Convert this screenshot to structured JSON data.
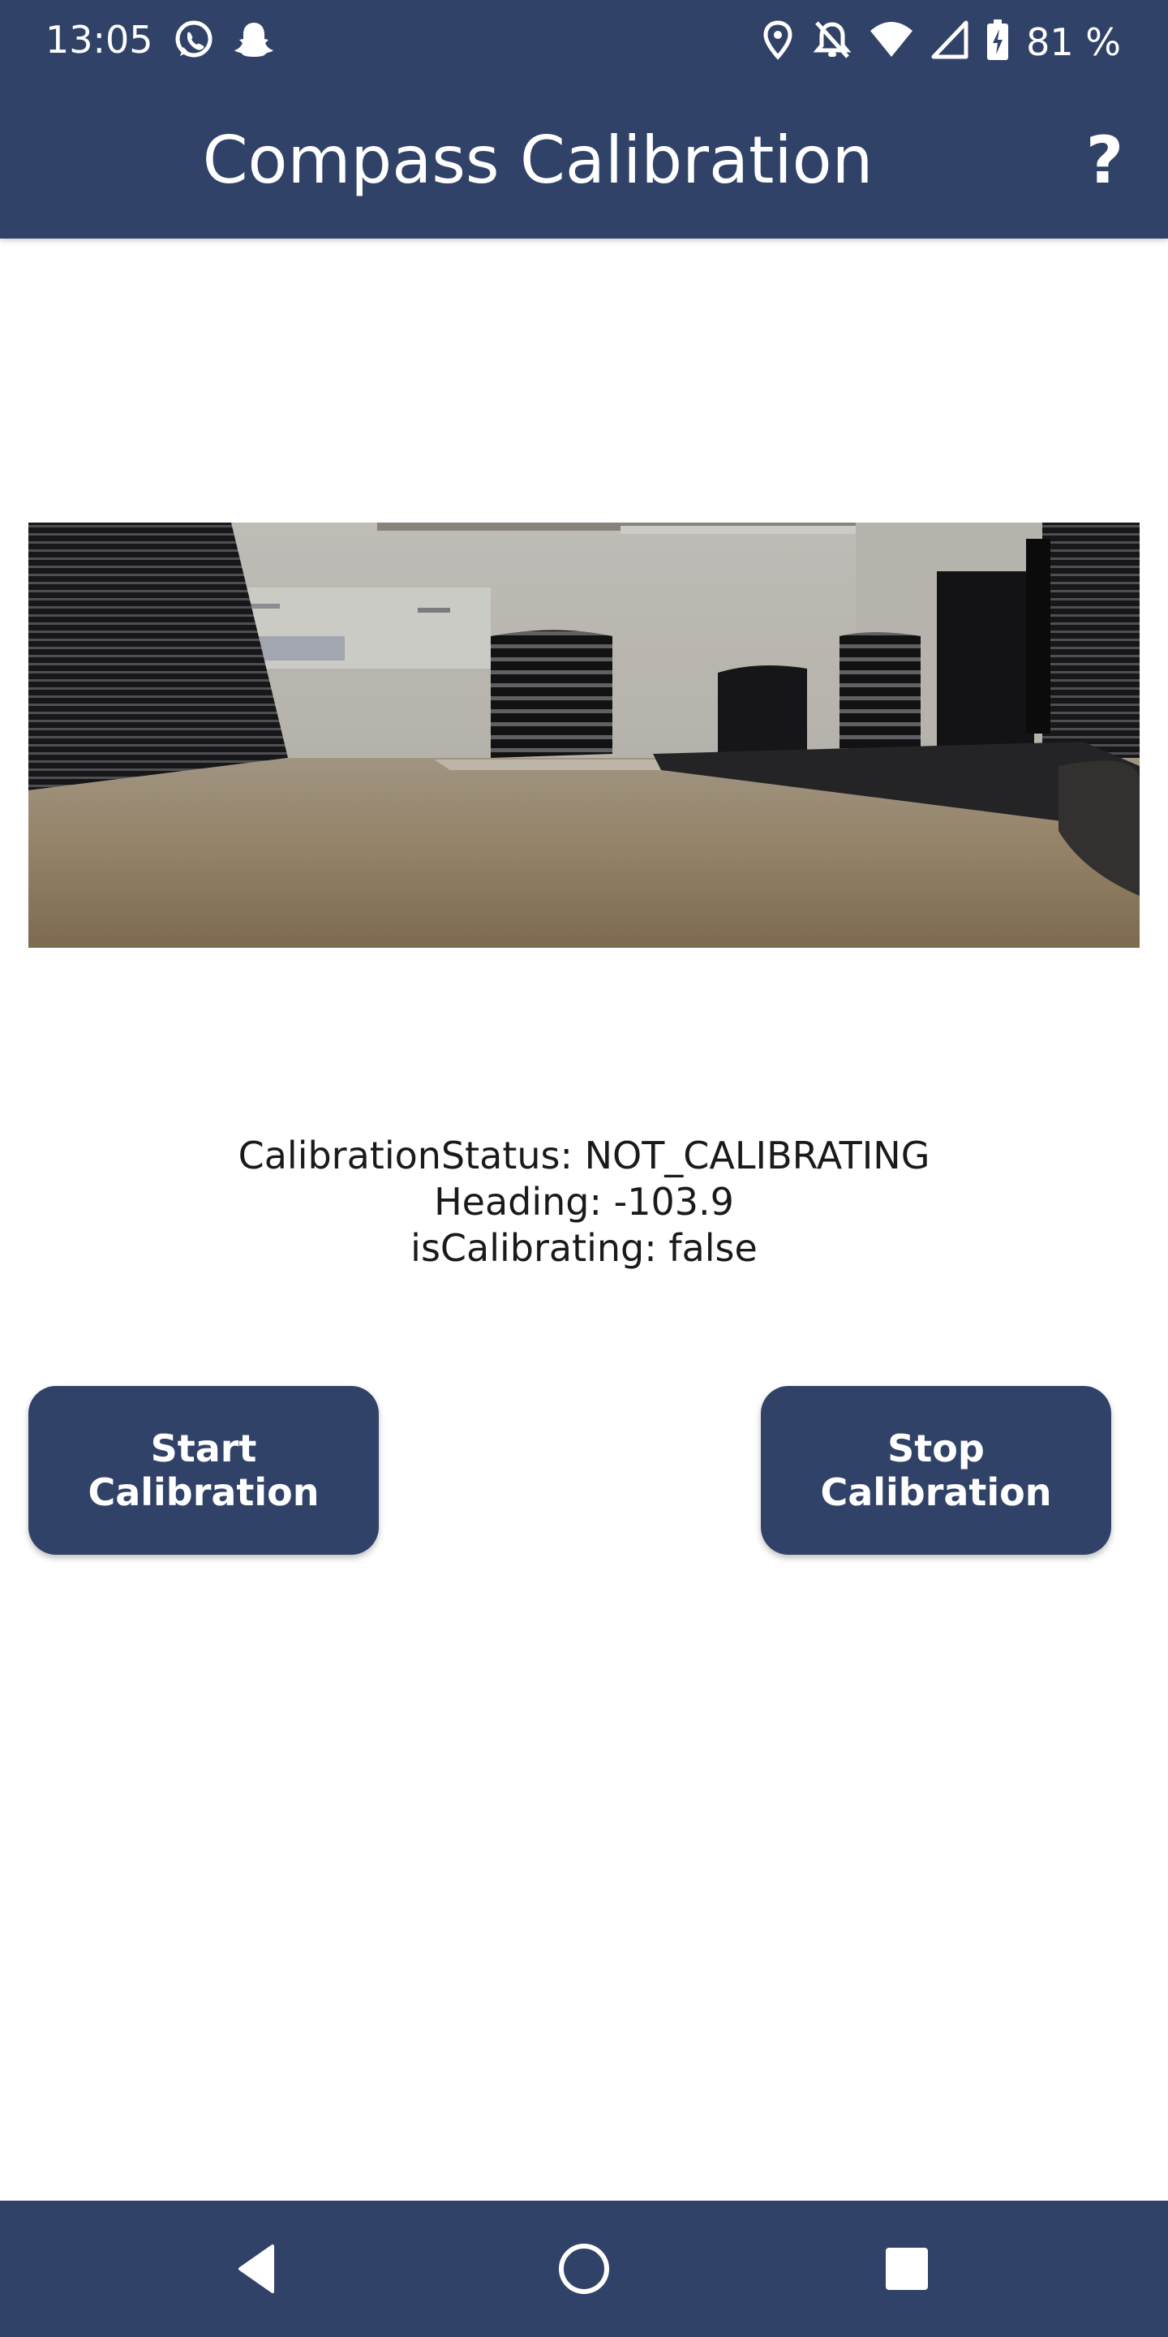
{
  "status_bar": {
    "time": "13:05",
    "left_icons": [
      "whatsapp-icon",
      "snapchat-icon"
    ],
    "right_icons": [
      "location-icon",
      "notifications-off-icon",
      "wifi-icon",
      "cell-signal-icon",
      "battery-charging-icon"
    ],
    "battery_percent": "81 %"
  },
  "app_bar": {
    "title": "Compass Calibration",
    "help_label": "?"
  },
  "camera": {
    "description_icon": "camera-preview-image"
  },
  "calibration": {
    "status_line": "CalibrationStatus: NOT_CALIBRATING",
    "heading_line": "Heading: -103.9",
    "is_calibrating_line": "isCalibrating: false"
  },
  "buttons": {
    "start_label": "Start Calibration",
    "stop_label": "Stop Calibration"
  },
  "nav_bar": {
    "items": [
      "back-icon",
      "home-icon",
      "recents-icon"
    ]
  },
  "colors": {
    "primary": "#314268",
    "background": "#ffffff",
    "text": "#1a1a1a",
    "on_primary": "#ffffff"
  }
}
